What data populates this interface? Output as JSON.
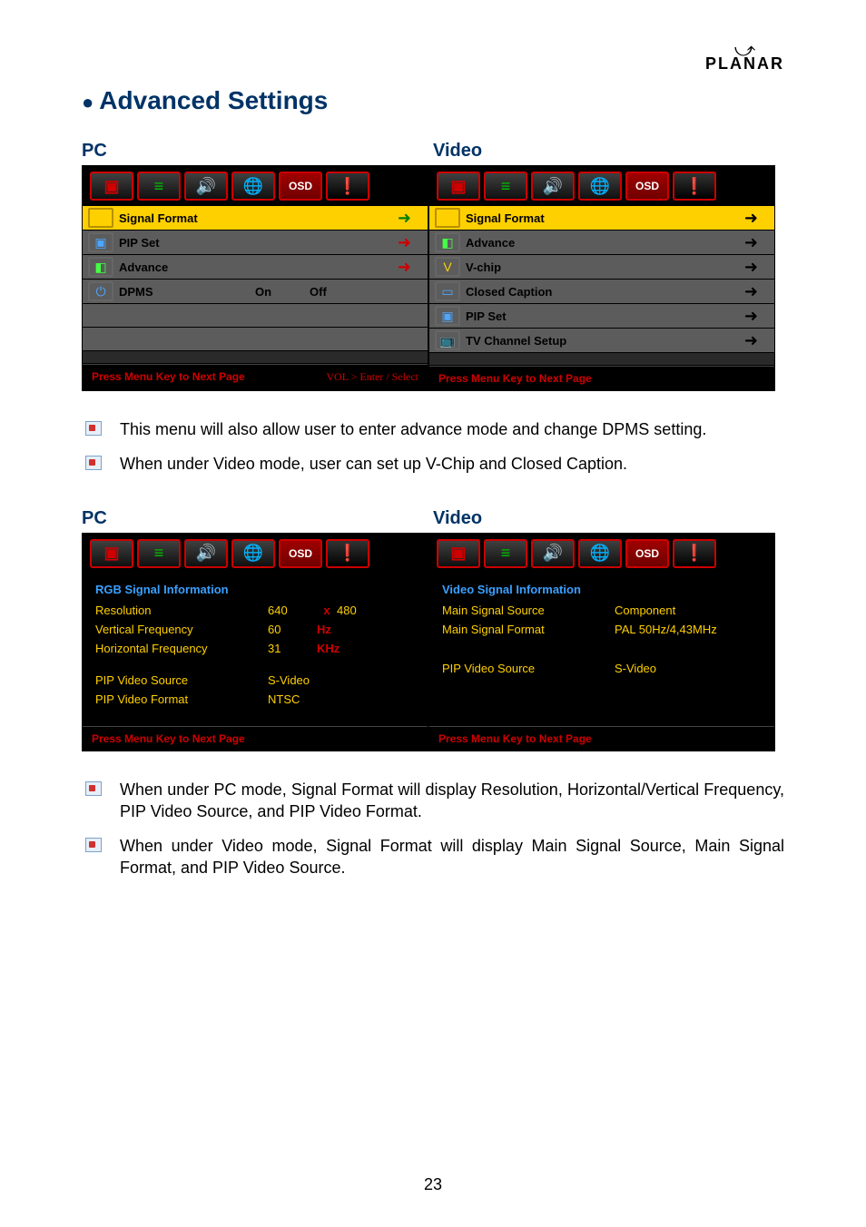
{
  "logo": "PLANAR",
  "page_title": "Advanced Settings",
  "labels": {
    "pc": "PC",
    "video": "Video"
  },
  "tabs_osd_label": "OSD",
  "panel1": {
    "pc": {
      "rows": [
        {
          "label": "Signal Format",
          "hl": true
        },
        {
          "label": "PIP Set"
        },
        {
          "label": "Advance"
        },
        {
          "label": "DPMS",
          "v1": "On",
          "v2": "Off"
        }
      ],
      "footer_left": "Press Menu Key to Next Page",
      "footer_right": "VOL > Enter / Select"
    },
    "video": {
      "rows": [
        {
          "label": "Signal Format",
          "hl": true
        },
        {
          "label": "Advance"
        },
        {
          "label": "V-chip"
        },
        {
          "label": "Closed Caption"
        },
        {
          "label": "PIP Set"
        },
        {
          "label": "TV Channel Setup"
        }
      ],
      "footer_left": "Press Menu Key to Next Page"
    }
  },
  "bullets1": [
    "This menu will also allow user to enter advance mode and change DPMS setting.",
    "When under Video mode, user can set up V-Chip and Closed Caption."
  ],
  "panel2": {
    "pc": {
      "title": "RGB Signal Information",
      "resolution_label": "Resolution",
      "resolution_w": "640",
      "resolution_x": "x",
      "resolution_h": "480",
      "vfreq_label": "Vertical Frequency",
      "vfreq_val": "60",
      "vfreq_unit": "Hz",
      "hfreq_label": "Horizontal Frequency",
      "hfreq_val": "31",
      "hfreq_unit": "KHz",
      "pip_src_label": "PIP Video Source",
      "pip_src_val": "S-Video",
      "pip_fmt_label": "PIP Video Format",
      "pip_fmt_val": "NTSC",
      "footer": "Press Menu Key to Next Page"
    },
    "video": {
      "title": "Video Signal Information",
      "main_src_label": "Main Signal Source",
      "main_src_val": "Component",
      "main_fmt_label": "Main Signal Format",
      "main_fmt_val": "PAL 50Hz/4,43MHz",
      "pip_src_label": "PIP Video Source",
      "pip_src_val": "S-Video",
      "footer": "Press Menu Key to Next Page"
    }
  },
  "bullets2": [
    "When under PC mode, Signal Format will display Resolution, Horizontal/Vertical Frequency, PIP Video Source, and PIP Video Format.",
    "When under Video mode, Signal Format will display Main Signal Source, Main Signal Format, and PIP Video Source."
  ],
  "page_number": "23"
}
